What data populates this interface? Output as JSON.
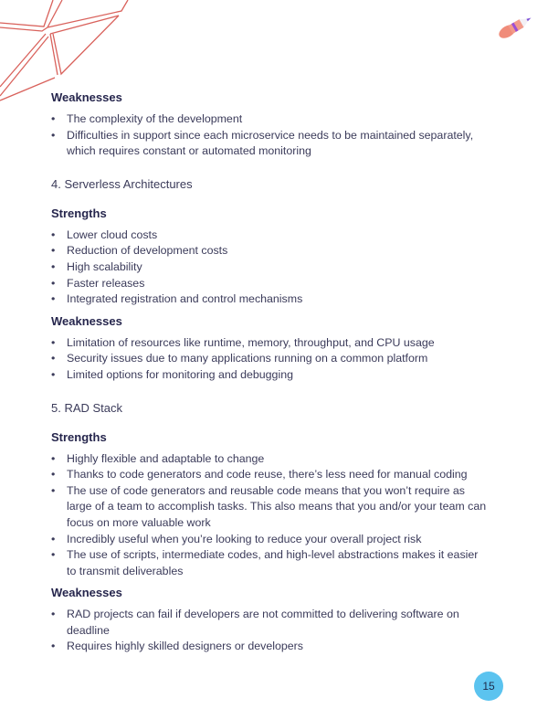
{
  "sections": [
    {
      "title": null,
      "groups": [
        {
          "heading": "Weaknesses",
          "items": [
            "The complexity of the development",
            "Difficulties in support since each microservice needs to be maintained separately, which requires constant or automated monitoring"
          ]
        }
      ]
    },
    {
      "title": "4.  Serverless Architectures",
      "groups": [
        {
          "heading": "Strengths",
          "items": [
            "Lower cloud costs",
            "Reduction of development costs",
            "High scalability",
            "Faster releases",
            "Integrated registration and control mechanisms"
          ]
        },
        {
          "heading": "Weaknesses",
          "items": [
            "Limitation of resources like runtime, memory, throughput, and CPU usage",
            "Security issues due to many applications running on a common platform",
            "Limited options for monitoring and debugging"
          ]
        }
      ]
    },
    {
      "title": "5. RAD Stack",
      "groups": [
        {
          "heading": "Strengths",
          "items": [
            "Highly flexible and adaptable to change",
            "Thanks to code generators and code reuse, there’s less need for manual coding",
            "The use of code generators and reusable code means that you won’t require as large of a team to accomplish tasks. This also means that you and/or your team can focus on more valuable work",
            "Incredibly useful when you’re looking to reduce your overall project risk",
            "The use of scripts, intermediate codes, and high-level abstractions makes it easier to transmit deliverables"
          ]
        },
        {
          "heading": "Weaknesses",
          "items": [
            "RAD projects can fail if developers are not committed to delivering software on deadline",
            "Requires highly skilled designers or developers"
          ]
        }
      ]
    }
  ],
  "bullet_char": "•",
  "page_number": "15",
  "decorations": {
    "top_left": "geometric-lines-decoration",
    "top_right": "pencil-icon"
  },
  "colors": {
    "heading": "#26264d",
    "body": "#3b3b5a",
    "deco_lines": "#d9534f",
    "page_badge": "#5bc3ef"
  }
}
